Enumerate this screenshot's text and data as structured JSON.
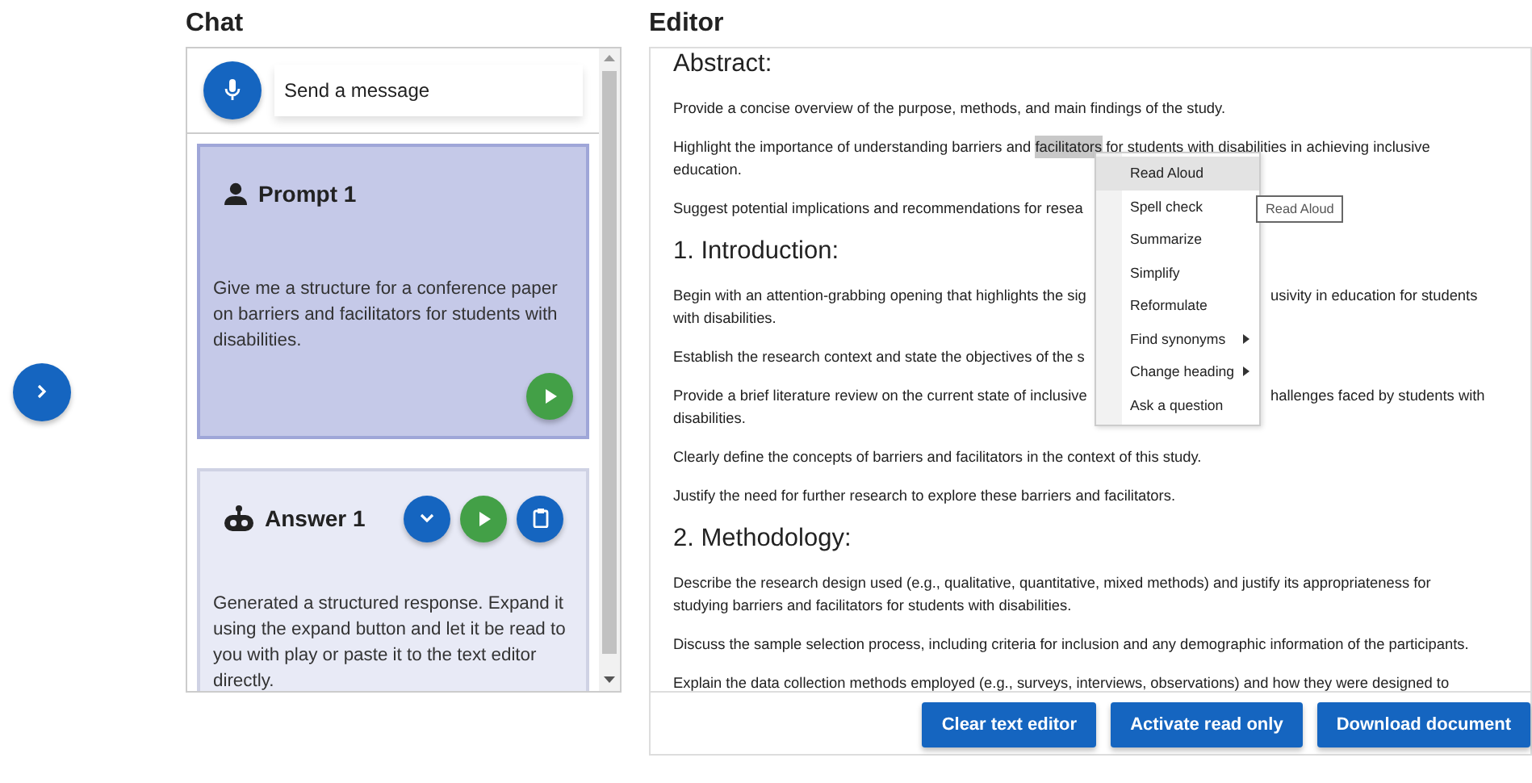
{
  "chat": {
    "title": "Chat",
    "input": {
      "placeholder": "Send a message"
    },
    "messages": [
      {
        "kind": "prompt",
        "title": "Prompt 1",
        "text": "Give me a structure for a conference paper on barriers and facilitators for students with disabilities.",
        "actions": [
          {
            "kind": "play"
          }
        ]
      },
      {
        "kind": "answer",
        "title": "Answer 1",
        "text": "Generated a structured response. Expand it using the expand button and let it be read to you with play or paste it to the text editor directly.",
        "actions": [
          {
            "kind": "expand"
          },
          {
            "kind": "play"
          },
          {
            "kind": "paste"
          }
        ]
      }
    ]
  },
  "editor": {
    "title": "Editor",
    "blocks": [
      {
        "kind": "heading",
        "text": "Abstract:"
      },
      {
        "kind": "paragraph",
        "text": "Provide a concise overview of the purpose, methods, and main findings of the study."
      },
      {
        "kind": "lines",
        "lines": [
          {
            "parts": [
              {
                "kind": "text",
                "text": "Highlight the importance of understanding barriers and "
              },
              {
                "kind": "highlight",
                "text": "facilitators"
              },
              {
                "kind": "text",
                "text": " for students with disabilities in achieving inclusive"
              }
            ]
          },
          {
            "parts": [
              {
                "kind": "text",
                "text": "education."
              }
            ]
          }
        ]
      },
      {
        "kind": "paragraph",
        "text": "Suggest potential implications and recommendations for resea"
      },
      {
        "kind": "heading",
        "text": "1. Introduction:"
      },
      {
        "kind": "lines",
        "lines": [
          {
            "parts": [
              {
                "kind": "text",
                "text": "Begin with an attention-grabbing opening that highlights the sig"
              },
              {
                "kind": "covered"
              },
              {
                "kind": "text",
                "text": "usivity in education for students"
              }
            ]
          },
          {
            "parts": [
              {
                "kind": "text",
                "text": "with disabilities."
              }
            ]
          }
        ]
      },
      {
        "kind": "paragraph",
        "text": "Establish the research context and state the objectives of the s"
      },
      {
        "kind": "lines",
        "lines": [
          {
            "parts": [
              {
                "kind": "text",
                "text": "Provide a brief literature review on the current state of inclusive"
              },
              {
                "kind": "covered"
              },
              {
                "kind": "text",
                "text": "hallenges faced by students with"
              }
            ]
          },
          {
            "parts": [
              {
                "kind": "text",
                "text": "disabilities."
              }
            ]
          }
        ]
      },
      {
        "kind": "paragraph",
        "text": "Clearly define the concepts of barriers and facilitators in the context of this study."
      },
      {
        "kind": "paragraph",
        "text": "Justify the need for further research to explore these barriers and facilitators."
      },
      {
        "kind": "heading",
        "text": "2. Methodology:"
      },
      {
        "kind": "paragraph",
        "text": "Describe the research design used (e.g., qualitative, quantitative, mixed methods) and justify its appropriateness for studying barriers and facilitators for students with disabilities."
      },
      {
        "kind": "paragraph",
        "text": "Discuss the sample selection process, including criteria for inclusion and any demographic information of the participants."
      },
      {
        "kind": "paragraph",
        "text": "Explain the data collection methods employed (e.g., surveys, interviews, observations) and how they were designed to"
      }
    ],
    "context_menu": [
      {
        "label": "Read Aloud",
        "selected": true,
        "submenu": false
      },
      {
        "label": "Spell check",
        "selected": false,
        "submenu": false
      },
      {
        "label": "Summarize",
        "selected": false,
        "submenu": false
      },
      {
        "label": "Simplify",
        "selected": false,
        "submenu": false
      },
      {
        "label": "Reformulate",
        "selected": false,
        "submenu": false
      },
      {
        "label": "Find synonyms",
        "selected": false,
        "submenu": true
      },
      {
        "label": "Change heading",
        "selected": false,
        "submenu": true
      },
      {
        "label": "Ask a question",
        "selected": false,
        "submenu": false
      }
    ],
    "tooltip": "Read Aloud",
    "buttons": [
      "Clear text editor",
      "Activate read only",
      "Download document"
    ]
  }
}
